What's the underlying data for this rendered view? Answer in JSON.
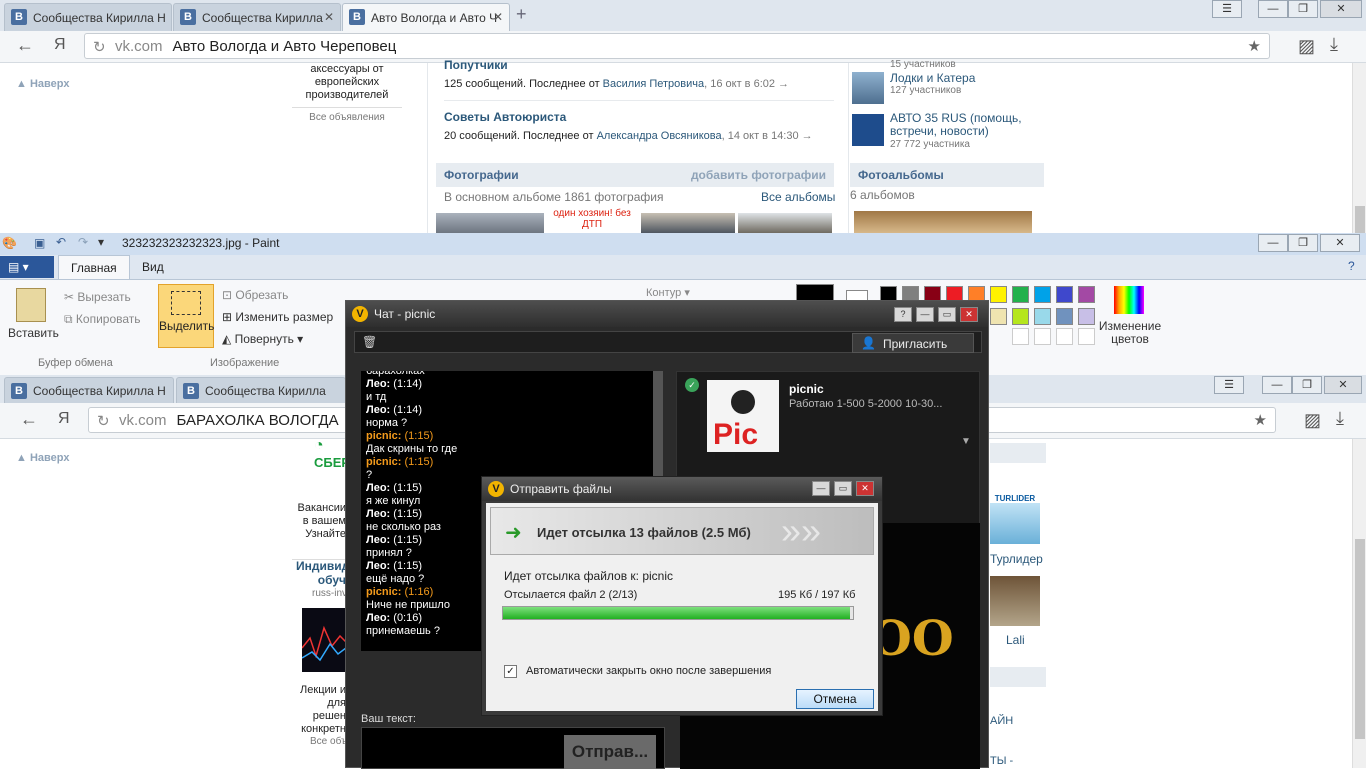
{
  "browser1": {
    "tabs": [
      "Сообщества Кирилла Н",
      "Сообщества Кирилла",
      "Авто Вологда и Авто Ч"
    ],
    "host": "vk.com",
    "title": "Авто Вологда и Авто Череповец",
    "ya": "Я"
  },
  "vk1": {
    "back_top": "Наверх",
    "ad_text": "аксессуары от европейских производителей",
    "all_ads": "Все объявления",
    "topics": [
      {
        "title": "Попутчики",
        "meta": "125 сообщений. Последнее от",
        "author": "Василия Петровича",
        "date": ", 16 окт в 6:02  →"
      },
      {
        "title": "Советы Автоюриста",
        "meta": "20 сообщений. Последнее от",
        "author": "Александра Овсяникова",
        "date": ", 14 окт в 14:30  →"
      }
    ],
    "photos_hdr": "Фотографии",
    "add_photos": "добавить фотографии",
    "photos_count": "В основном альбоме 1861 фотография",
    "all_albums": "Все альбомы",
    "photo_caption": "один хозяин! без ДТП",
    "groups": [
      {
        "name": "Лодки и Катера",
        "count": "127 участников"
      },
      {
        "name": "АВТО 35 RUS (помощь, встречи, новости)",
        "count": "27 772 участника"
      }
    ],
    "groups_top_count": "15 участников",
    "albums_hdr": "Фотоальбомы",
    "albums_count": "6 альбомов"
  },
  "paint": {
    "title": "323232323232323.jpg - Paint",
    "tabs": [
      "Главная",
      "Вид"
    ],
    "paste": "Вставить",
    "cut": "Вырезать",
    "copy": "Копировать",
    "clipboard": "Буфер обмена",
    "select": "Выделить",
    "crop": "Обрезать",
    "resize": "Изменить размер",
    "rotate": "Повернуть",
    "image": "Изображение",
    "contour": "Контур",
    "edit_colors": "Изменение цветов",
    "palette": [
      "#000000",
      "#7f7f7f",
      "#880015",
      "#ed1c24",
      "#ff7f27",
      "#fff200",
      "#22b14c",
      "#00a2e8",
      "#3f48cc",
      "#a349a4",
      "#ffffff",
      "#c3c3c3",
      "#b97a57",
      "#ffaec9",
      "#ffc90e",
      "#efe4b0",
      "#b5e61d",
      "#99d9ea",
      "#7092be",
      "#c8bfe7"
    ]
  },
  "browser2": {
    "tabs": [
      "Сообщества Кирилла Н",
      "Сообщества Кирилла"
    ],
    "host": "vk.com",
    "title": "БАРАХОЛКА ВОЛОГДА",
    "ya": "Я"
  },
  "vk2": {
    "back_top": "Наверх",
    "sber": "СБЕР",
    "ad1": "Вакансии в вашем Узнайте",
    "ad2_title": "Индивид обуч",
    "ad2_src": "russ-inv",
    "ad2_text": "Лекции и для решен конкретн",
    "all_ads": "Все объ",
    "turlider_logo": "TURLIDER",
    "friends": [
      "Турлидер",
      "Lali"
    ],
    "right_text1": "АЙН",
    "right_text2": "ТЫ -"
  },
  "chat": {
    "title": "Чат - picnic",
    "invite": "Пригласить",
    "contact_name": "picnic",
    "contact_status": "Работаю 1-500 5-2000 10-30...",
    "your_text": "Ваш текст:",
    "send": "Отправ...",
    "bg_text": "OO",
    "messages": [
      {
        "who": "",
        "time": "",
        "text": "барахолках"
      },
      {
        "who": "Лео:",
        "time": "(1:14)",
        "text": "и тд"
      },
      {
        "who": "Лео:",
        "time": "(1:14)",
        "text": "норма ?"
      },
      {
        "who": "picnic:",
        "time": "(1:15)",
        "text": "Дак скрины то где",
        "me": true
      },
      {
        "who": "picnic:",
        "time": "(1:15)",
        "text": "?",
        "me": true
      },
      {
        "who": "Лео:",
        "time": "(1:15)",
        "text": "я же кинул"
      },
      {
        "who": "Лео:",
        "time": "(1:15)",
        "text": "не сколько раз"
      },
      {
        "who": "Лео:",
        "time": "(1:15)",
        "text": "принял ?"
      },
      {
        "who": "Лео:",
        "time": "(1:15)",
        "text": "ещё надо ?"
      },
      {
        "who": "picnic:",
        "time": "(1:16)",
        "text": "Ниче не пришло",
        "me": true
      },
      {
        "who": "Лео:",
        "time": "(0:16)",
        "text": "принемаешь ?"
      }
    ]
  },
  "send": {
    "title": "Отправить файлы",
    "banner": "Идет отсылка 13 файлов (2.5 Мб)",
    "to": "Идет отсылка файлов к: picnic",
    "file": "Отсылается файл 2 (2/13)",
    "size": "195 Кб / 197 Кб",
    "progress": 0.99,
    "auto_close": "Автоматически закрыть окно после завершения",
    "cancel": "Отмена"
  }
}
